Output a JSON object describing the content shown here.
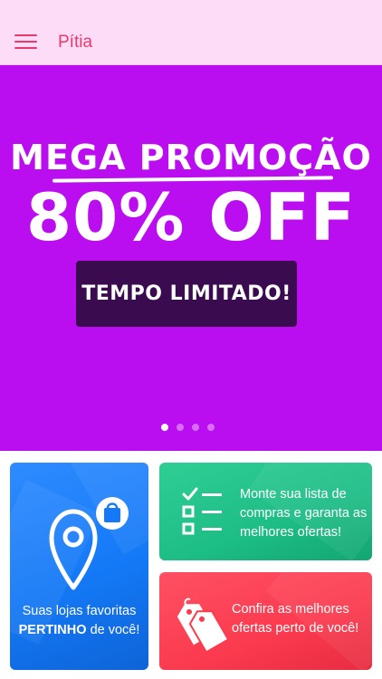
{
  "header": {
    "title": "Pítia",
    "menu_icon": "hamburger-menu-icon",
    "background": "#fddcf7",
    "accent": "#e83a6a"
  },
  "banner": {
    "background": "#bb0ef0",
    "headline": "MEGA PROMOÇÃO",
    "discount": "80% OFF",
    "cta_label": "TEMPO LIMITADO!",
    "slides_count": 4,
    "active_slide_index": 0
  },
  "cards": {
    "stores": {
      "icon": "map-pin-with-shopping-bag-icon",
      "text_pre": "Suas lojas favoritas",
      "text_bold": "PERTINHO",
      "text_post": "de você!",
      "color": "#1479f6"
    },
    "shopping_list": {
      "icon": "checklist-icon",
      "text": "Monte sua lista de compras e garanta as melhores ofertas!",
      "color": "#1dbd86"
    },
    "offers": {
      "icon": "price-tags-icon",
      "text": "Confira as melhores ofertas perto de você!",
      "color": "#fb3a4e"
    }
  }
}
